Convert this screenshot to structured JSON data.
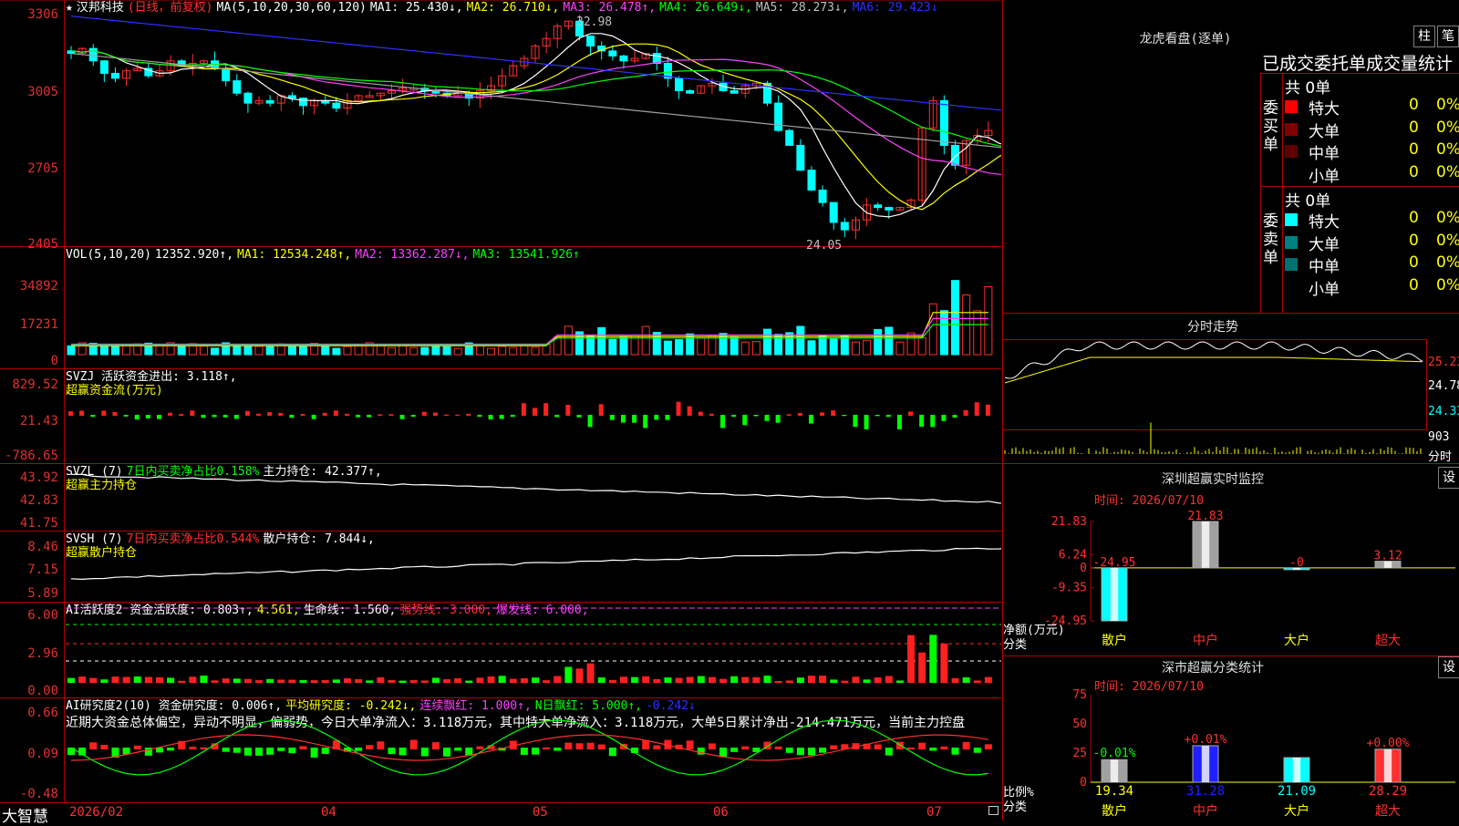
{
  "stock": {
    "name": "汉邦科技",
    "star": "★",
    "period": "(日线，前复权)"
  },
  "main_panel": {
    "ma_label": "MA(5,10,20,30,60,120)",
    "ma": [
      {
        "text": "MA1: 25.430↓,",
        "color": "#ffffff"
      },
      {
        "text": "MA2: 26.710↓,",
        "color": "#ffff00"
      },
      {
        "text": "MA3: 26.478↑,",
        "color": "#ff40ff"
      },
      {
        "text": "MA4: 26.649↓,",
        "color": "#00ff00"
      },
      {
        "text": "MA5: 28.273↓,",
        "color": "#c0c0c0"
      },
      {
        "text": "MA6: 29.423↓",
        "color": "#3030ff"
      }
    ],
    "y_ticks": [
      "3306",
      "3005",
      "2705",
      "2405"
    ],
    "high_label": "32.98",
    "low_label": "24.05"
  },
  "vol_panel": {
    "label": "VOL(5,10,20)",
    "values": [
      {
        "text": "12352.920↑,",
        "color": "#ffffff"
      },
      {
        "text": "MA1: 12534.248↑,",
        "color": "#ffff00"
      },
      {
        "text": "MA2: 13362.287↓,",
        "color": "#ff40ff"
      },
      {
        "text": "MA3: 13541.926↑",
        "color": "#00ff00"
      }
    ],
    "y_ticks": [
      "34892",
      "17231",
      "0"
    ]
  },
  "svzj_panel": {
    "line1": [
      {
        "text": "SVZJ  活跃资金进出: 3.118↑,",
        "color": "#ffffff"
      }
    ],
    "line2": "超赢资金流(万元)",
    "y_ticks": [
      "829.52",
      "21.43",
      "-786.65"
    ]
  },
  "svzl_panel": {
    "line1": [
      {
        "text": "SVZL (7)",
        "color": "#ffffff"
      },
      {
        "text": "7日内买卖净占比0.158%",
        "color": "#00ff00"
      },
      {
        "text": "主力持仓: 42.377↑,",
        "color": "#ffffff"
      }
    ],
    "line2": "超赢主力持仓",
    "y_ticks": [
      "43.92",
      "42.83",
      "41.75"
    ]
  },
  "svsh_panel": {
    "line1": [
      {
        "text": "SVSH (7)",
        "color": "#ffffff"
      },
      {
        "text": "7日内买卖净占比0.544%",
        "color": "#ff3030"
      },
      {
        "text": "散户持仓: 7.844↓,",
        "color": "#ffffff"
      }
    ],
    "line2": "超赢散户持仓",
    "y_ticks": [
      "8.46",
      "7.15",
      "5.89"
    ]
  },
  "ai_activity_panel": {
    "line1": [
      {
        "text": "AI活跃度2 资金活跃度: 0.803↑,",
        "color": "#ffffff"
      },
      {
        "text": "4.561,",
        "color": "#ffff00"
      },
      {
        "text": "生命线: 1.560,",
        "color": "#ffffff"
      },
      {
        "text": "强势线: 3.000,",
        "color": "#ff3030"
      },
      {
        "text": "爆发线: 6.000,",
        "color": "#ff40ff"
      }
    ],
    "y_ticks": [
      "6.00",
      "2.96",
      "0.00"
    ]
  },
  "ai_research_panel": {
    "line1": [
      {
        "text": "AI研究度2(10) 资金研究度: 0.006↑,",
        "color": "#ffffff"
      },
      {
        "text": "平均研究度: -0.242↓,",
        "color": "#ffff00"
      },
      {
        "text": "连续飘红: 1.000↑,",
        "color": "#ff40ff"
      },
      {
        "text": "N日飘红: 5.000↑,",
        "color": "#00ff00"
      },
      {
        "text": "-0.242↓",
        "color": "#3030ff"
      }
    ],
    "summary": "近期大资金总体偏空，异动不明显，偏弱势，今日大单净流入：3.118万元，其中特大单净流入：3.118万元，大单5日累计净出-214.471万元，当前主力控盘",
    "y_ticks": [
      "0.66",
      "0.09",
      "-0.48"
    ]
  },
  "x_axis": {
    "brand": "大智慧",
    "labels": [
      "2026/02",
      "04",
      "05",
      "06",
      "07"
    ]
  },
  "dragon_tiger": {
    "title": "龙虎看盘(逐单)",
    "btn1": "柱",
    "btn2": "笔",
    "subtitle": "已成交委托单成交量统计",
    "buy_side": "委买单",
    "sell_side": "委卖单",
    "buy_total": "共 0单",
    "sell_total": "共 0单",
    "buy_rows": [
      {
        "label": "特大",
        "count": "0",
        "pct": "0%",
        "color": "#ff0000"
      },
      {
        "label": "大单",
        "count": "0",
        "pct": "0%",
        "color": "#800000"
      },
      {
        "label": "中单",
        "count": "0",
        "pct": "0%",
        "color": "#600000"
      },
      {
        "label": "小单",
        "count": "0",
        "pct": "0%",
        "color": ""
      }
    ],
    "sell_rows": [
      {
        "label": "特大",
        "count": "0",
        "pct": "0%",
        "color": "#00ffff"
      },
      {
        "label": "大单",
        "count": "0",
        "pct": "0%",
        "color": "#008080"
      },
      {
        "label": "中单",
        "count": "0",
        "pct": "0%",
        "color": "#007070"
      },
      {
        "label": "小单",
        "count": "0",
        "pct": "0%",
        "color": ""
      }
    ]
  },
  "intraday": {
    "title": "分时走势",
    "y_ticks": [
      "25.23",
      "24.78",
      "24.33"
    ],
    "vol_ticks": [
      "903",
      "分时"
    ]
  },
  "sz_monitor": {
    "title": "深圳超赢实时监控",
    "btn": "设",
    "time_label": "时间: 2026/07/10",
    "y_ticks": [
      "21.83",
      "6.24",
      "0",
      "-9.35",
      "-24.95"
    ],
    "y_unit": "净额(万元)",
    "x_unit": "分类",
    "categories": [
      "散户",
      "中户",
      "大户",
      "超大"
    ],
    "values": [
      -24.95,
      21.83,
      -0.0,
      3.12
    ],
    "value_labels": [
      "-24.95",
      "21.83",
      "-0",
      "3.12"
    ]
  },
  "sz_class": {
    "title": "深市超赢分类统计",
    "btn": "设",
    "time_label": "时间: 2026/07/10",
    "y_ticks": [
      "75",
      "50",
      "25",
      "0"
    ],
    "y_unit": "比例%",
    "x_unit": "分类",
    "categories": [
      "散户",
      "中户",
      "大户",
      "超大"
    ],
    "values": [
      19.34,
      31.28,
      21.09,
      28.29
    ],
    "value_labels": [
      "19.34",
      "31.28",
      "21.09",
      "28.29"
    ],
    "change_labels": [
      "-0.01%",
      "+0.01%",
      "",
      "+0.00%"
    ]
  },
  "chart_data": {
    "type": "bar",
    "title": "深圳超赢实时监控",
    "categories": [
      "散户",
      "中户",
      "大户",
      "超大"
    ],
    "values": [
      -24.95,
      21.83,
      -0.0,
      3.12
    ],
    "ylabel": "净额(万元)",
    "xlabel": "分类",
    "ylim": [
      -24.95,
      21.83
    ]
  }
}
